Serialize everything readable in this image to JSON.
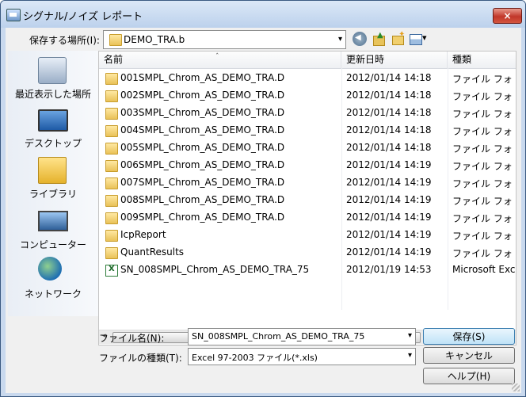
{
  "window": {
    "title": "シグナル/ノイズ レポート",
    "close_label": "×"
  },
  "location": {
    "label": "保存する場所(I):",
    "value": "DEMO_TRA.b",
    "arrow": "▾"
  },
  "places": [
    {
      "label": "最近表示した場所",
      "icon": "recent-places-icon"
    },
    {
      "label": "デスクトップ",
      "icon": "desktop-icon"
    },
    {
      "label": "ライブラリ",
      "icon": "library-icon"
    },
    {
      "label": "コンピューター",
      "icon": "computer-icon"
    },
    {
      "label": "ネットワーク",
      "icon": "network-icon"
    }
  ],
  "list": {
    "columns": [
      "名前",
      "更新日時",
      "種類"
    ],
    "sort_indicator": "ˆ",
    "rows": [
      {
        "name": "001SMPL_Chrom_AS_DEMO_TRA.D",
        "date": "2012/01/14 14:18",
        "type": "ファイル フォ",
        "icon": "folder"
      },
      {
        "name": "002SMPL_Chrom_AS_DEMO_TRA.D",
        "date": "2012/01/14 14:18",
        "type": "ファイル フォ",
        "icon": "folder"
      },
      {
        "name": "003SMPL_Chrom_AS_DEMO_TRA.D",
        "date": "2012/01/14 14:18",
        "type": "ファイル フォ",
        "icon": "folder"
      },
      {
        "name": "004SMPL_Chrom_AS_DEMO_TRA.D",
        "date": "2012/01/14 14:18",
        "type": "ファイル フォ",
        "icon": "folder"
      },
      {
        "name": "005SMPL_Chrom_AS_DEMO_TRA.D",
        "date": "2012/01/14 14:18",
        "type": "ファイル フォ",
        "icon": "folder"
      },
      {
        "name": "006SMPL_Chrom_AS_DEMO_TRA.D",
        "date": "2012/01/14 14:19",
        "type": "ファイル フォ",
        "icon": "folder"
      },
      {
        "name": "007SMPL_Chrom_AS_DEMO_TRA.D",
        "date": "2012/01/14 14:19",
        "type": "ファイル フォ",
        "icon": "folder"
      },
      {
        "name": "008SMPL_Chrom_AS_DEMO_TRA.D",
        "date": "2012/01/14 14:19",
        "type": "ファイル フォ",
        "icon": "folder"
      },
      {
        "name": "009SMPL_Chrom_AS_DEMO_TRA.D",
        "date": "2012/01/14 14:19",
        "type": "ファイル フォ",
        "icon": "folder"
      },
      {
        "name": "IcpReport",
        "date": "2012/01/14 14:19",
        "type": "ファイル フォ",
        "icon": "folder"
      },
      {
        "name": "QuantResults",
        "date": "2012/01/14 14:19",
        "type": "ファイル フォ",
        "icon": "folder"
      },
      {
        "name": "SN_008SMPL_Chrom_AS_DEMO_TRA_75",
        "date": "2012/01/19 14:53",
        "type": "Microsoft Exc",
        "icon": "excel-file"
      }
    ],
    "hscroll": {
      "left": "◂",
      "right": "▸",
      "thumb": "III"
    }
  },
  "filename": {
    "label": "ファイル名(N):",
    "value": "SN_008SMPL_Chrom_AS_DEMO_TRA_75",
    "arrow": "▾"
  },
  "filetype": {
    "label": "ファイルの種類(T):",
    "value": "Excel 97-2003 ファイル(*.xls)",
    "arrow": "▾"
  },
  "buttons": {
    "save": "保存(S)",
    "cancel": "キャンセル",
    "help": "ヘルプ(H)"
  }
}
